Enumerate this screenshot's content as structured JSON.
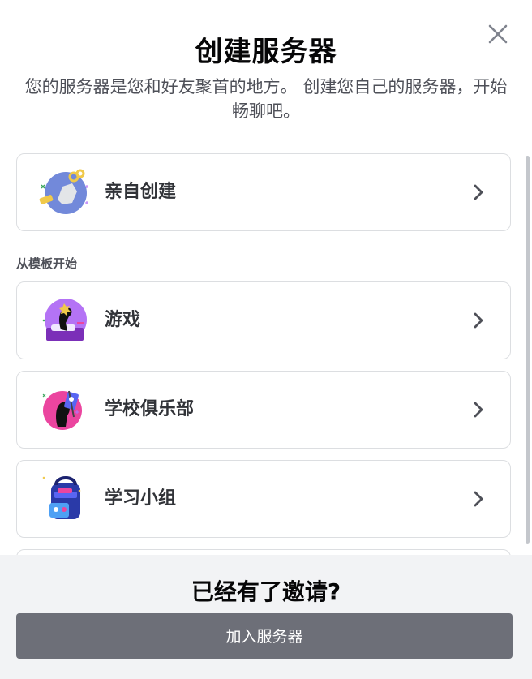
{
  "dialog": {
    "title": "创建服务器",
    "subtitle": "您的服务器是您和好友聚首的地方。 创建您自己的服务器，开始畅聊吧。"
  },
  "options": {
    "create_own": {
      "label": "亲自创建",
      "icon": "create-own-illustration"
    },
    "section_label": "从模板开始",
    "templates": [
      {
        "label": "游戏",
        "icon": "gaming-illustration"
      },
      {
        "label": "学校俱乐部",
        "icon": "school-club-illustration"
      },
      {
        "label": "学习小组",
        "icon": "study-group-illustration"
      }
    ]
  },
  "footer": {
    "title": "已经有了邀请?",
    "join_button": "加入服务器"
  },
  "colors": {
    "join_button_bg": "#6d6f78",
    "footer_bg": "#f2f3f5",
    "accent_blue": "#5865f2",
    "accent_purple": "#b473f5",
    "accent_pink": "#eb459f"
  }
}
